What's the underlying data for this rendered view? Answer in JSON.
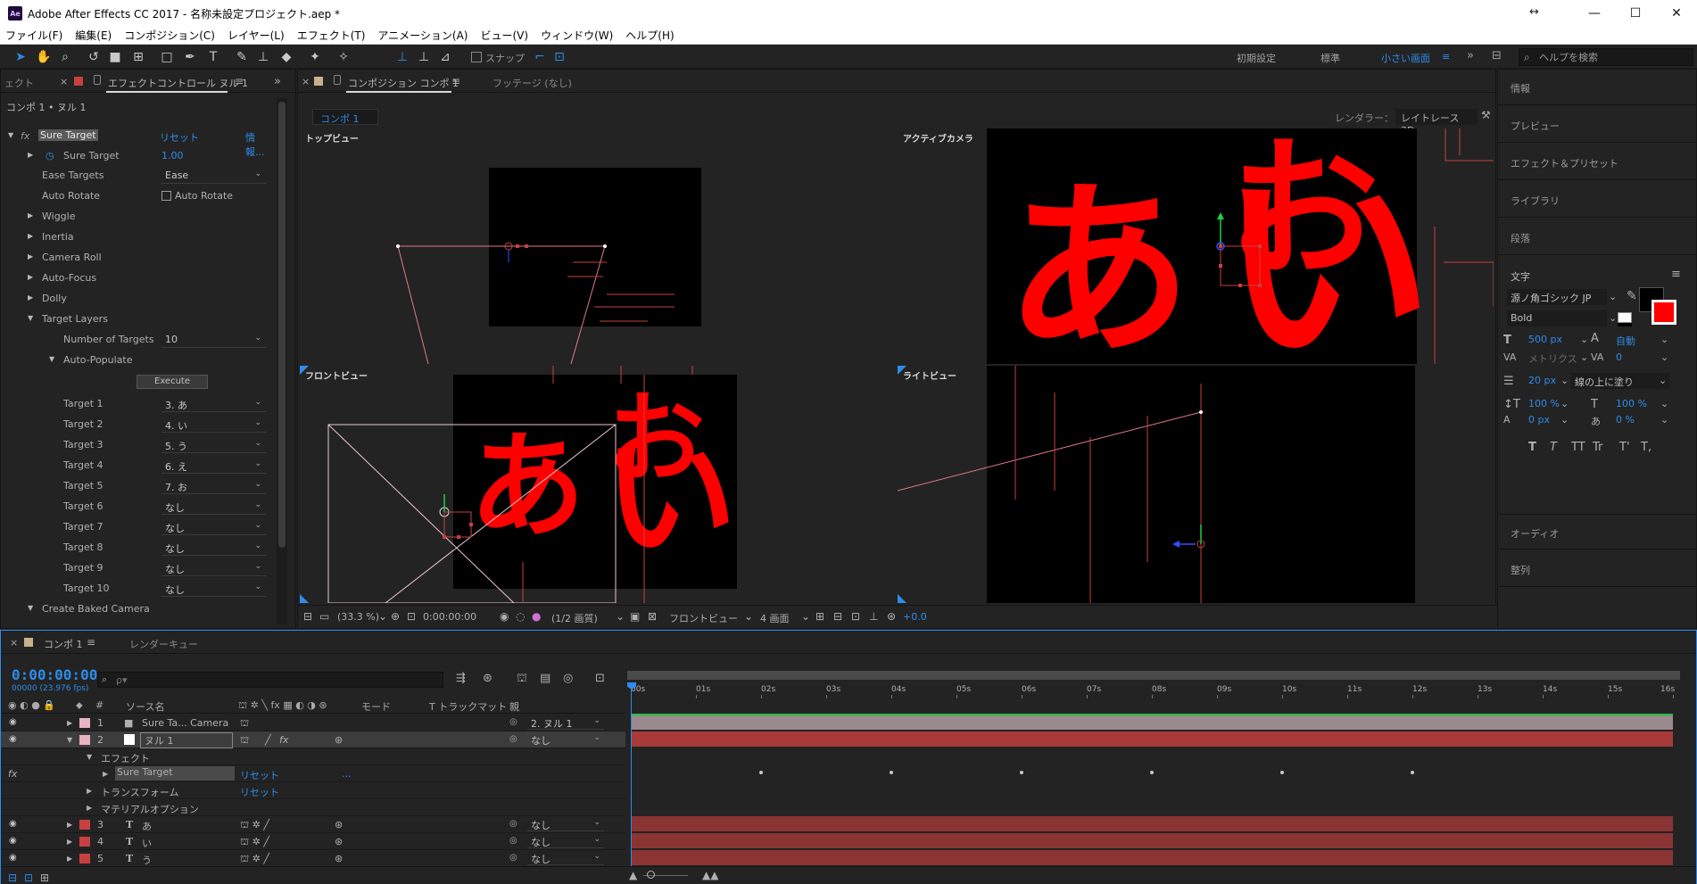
{
  "window": {
    "app_icon": "Ae",
    "title": "Adobe After Effects CC 2017 - 名称未設定プロジェクト.aep *"
  },
  "menu": [
    "ファイル(F)",
    "編集(E)",
    "コンポジション(C)",
    "レイヤー(L)",
    "エフェクト(T)",
    "アニメーション(A)",
    "ビュー(V)",
    "ウィンドウ(W)",
    "ヘルプ(H)"
  ],
  "toolbar": {
    "snap_label": "スナップ",
    "workspaces": [
      "初期設定",
      "標準",
      "小さい画面"
    ],
    "active_workspace": "小さい画面",
    "help_placeholder": "ヘルプを検索"
  },
  "effect_panel": {
    "left_tab": "ェクト",
    "tab_label": "エフェクトコントロール ヌル 1",
    "layer_path": "コンポ 1 • ヌル 1",
    "fx_label": "fx",
    "effect_name": "Sure Target",
    "reset": "リセット",
    "info": "情報...",
    "sure_target_value": "1.00",
    "sure_target_label": "Sure Target",
    "ease_targets_label": "Ease Targets",
    "ease_targets_value": "Ease",
    "auto_rotate_label": "Auto Rotate",
    "auto_rotate_checkbox": "Auto Rotate",
    "groups": [
      "Wiggle",
      "Inertia",
      "Camera Roll",
      "Auto-Focus",
      "Dolly"
    ],
    "target_layers_label": "Target Layers",
    "number_of_targets_label": "Number of Targets",
    "number_of_targets_value": "10",
    "auto_populate_label": "Auto-Populate",
    "execute_label": "Execute",
    "targets": [
      {
        "label": "Target 1",
        "value": "3. あ"
      },
      {
        "label": "Target 2",
        "value": "4. い"
      },
      {
        "label": "Target 3",
        "value": "5. う"
      },
      {
        "label": "Target 4",
        "value": "6. え"
      },
      {
        "label": "Target 5",
        "value": "7. お"
      },
      {
        "label": "Target 6",
        "value": "なし"
      },
      {
        "label": "Target 7",
        "value": "なし"
      },
      {
        "label": "Target 8",
        "value": "なし"
      },
      {
        "label": "Target 9",
        "value": "なし"
      },
      {
        "label": "Target 10",
        "value": "なし"
      }
    ],
    "create_baked_camera": "Create Baked Camera"
  },
  "comp_panel": {
    "tab_label": "コンポジション コンポ 1",
    "footage_tab": "フッテージ (なし)",
    "subtab": "コンポ 1",
    "renderer_label": "レンダラー：",
    "renderer_value": "レイトレース 3D",
    "views": {
      "top": "トップビュー",
      "active_camera": "アクティブカメラ",
      "front": "フロントビュー",
      "right": "ライトビュー"
    },
    "glyphs": {
      "a": "あ",
      "i": "い",
      "o": "お"
    },
    "bottom": {
      "zoom": "(33.3 %)",
      "timecode": "0:00:00:00",
      "resolution": "(1/2 画質)",
      "view": "フロントビュー",
      "layout": "4 画面",
      "exposure": "+0.0"
    }
  },
  "right_panel": {
    "sections": [
      "情報",
      "プレビュー",
      "エフェクト＆プリセット",
      "ライブラリ",
      "段落"
    ],
    "character": {
      "title": "文字",
      "font": "源ノ角ゴシック JP",
      "style": "Bold",
      "size": "500 px",
      "leading": "自動",
      "kerning": "メトリクス",
      "tracking": "0",
      "stroke": "20 px",
      "stroke_type": "線の上に塗り",
      "vscale": "100 %",
      "hscale": "100 %",
      "baseline": "0 px",
      "tsume": "0 %",
      "styles": [
        "T",
        "T",
        "TT",
        "Tr",
        "T'",
        "T,"
      ]
    },
    "lower_sections": [
      "オーディオ",
      "整列"
    ]
  },
  "timeline": {
    "tab_label": "コンポ 1",
    "render_queue_tab": "レンダーキュー",
    "timecode": "0:00:00:00",
    "fps": "00000 (23.976 fps)",
    "search_placeholder": "ρ▾",
    "columns": {
      "num": "#",
      "source": "ソース名",
      "mode": "モード",
      "trkmat": "T  トラックマット",
      "parent": "親"
    },
    "layers": [
      {
        "num": "1",
        "name": "Sure Ta... Camera",
        "parent": "2. ヌル 1",
        "color": "#e8b4c0"
      },
      {
        "num": "2",
        "name": "ヌル 1",
        "parent": "なし",
        "color": "#e8b4c0"
      },
      {
        "num": "3",
        "name": "あ",
        "parent": "なし",
        "color": "#c84040"
      },
      {
        "num": "4",
        "name": "い",
        "parent": "なし",
        "color": "#c84040"
      },
      {
        "num": "5",
        "name": "う",
        "parent": "なし",
        "color": "#c84040"
      }
    ],
    "sub": {
      "effects": "エフェクト",
      "sure_target": "Sure Target",
      "reset": "リセット",
      "dots": "...",
      "transform": "トランスフォーム",
      "transform_reset": "リセット",
      "material": "マテリアルオプション",
      "fx": "fx"
    },
    "ruler": [
      "00s",
      "01s",
      "02s",
      "03s",
      "04s",
      "05s",
      "06s",
      "07s",
      "08s",
      "09s",
      "10s",
      "11s",
      "12s",
      "13s",
      "14s",
      "15s",
      "16s"
    ],
    "keyframes_at": [
      2,
      4,
      6,
      8,
      10,
      12
    ]
  }
}
